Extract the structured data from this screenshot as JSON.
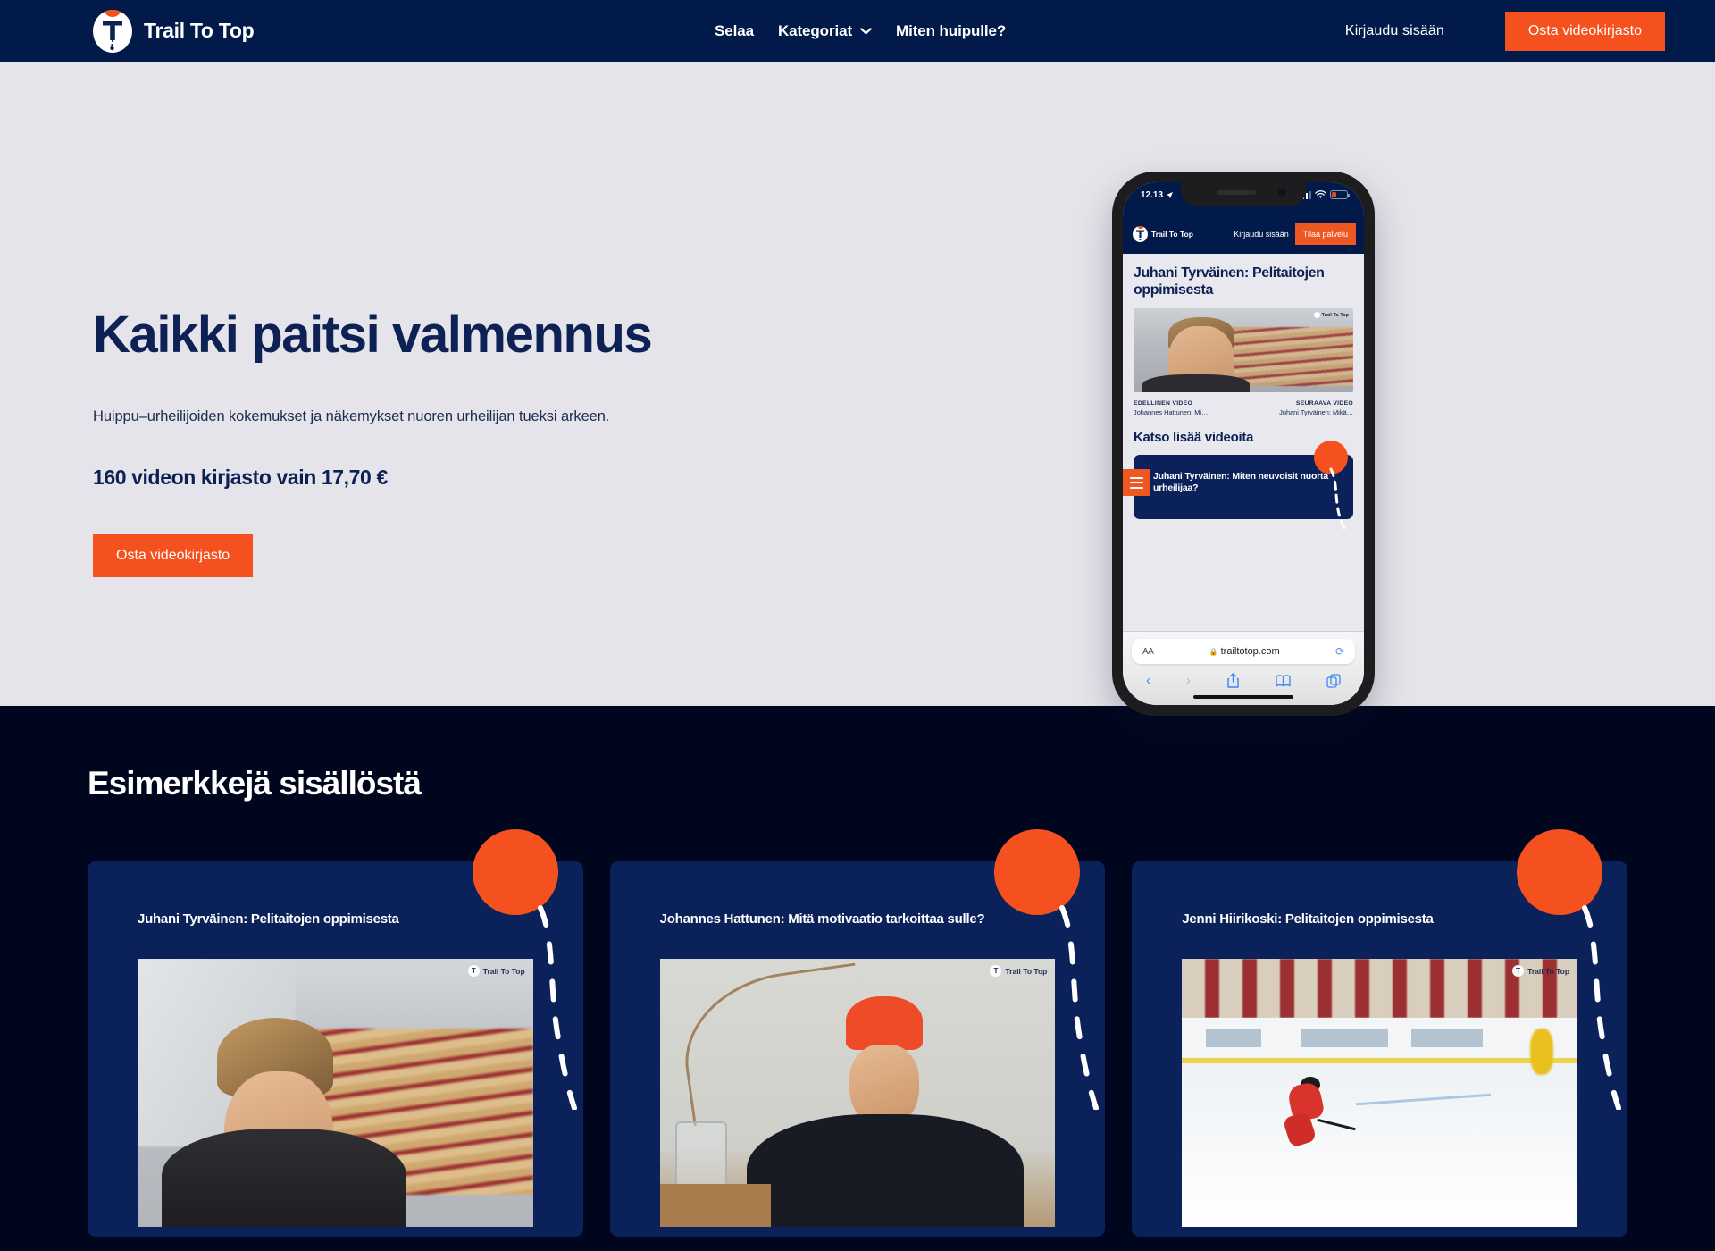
{
  "brand": {
    "name": "Trail To Top",
    "logo_icon": "trail-to-top-logo-icon"
  },
  "header": {
    "nav": [
      {
        "label": "Selaa",
        "has_dropdown": false
      },
      {
        "label": "Kategoriat",
        "has_dropdown": true,
        "dropdown_icon": "chevron-down-icon"
      },
      {
        "label": "Miten huipulle?",
        "has_dropdown": false
      }
    ],
    "login_label": "Kirjaudu sisään",
    "cta_label": "Osta videokirjasto"
  },
  "hero": {
    "title": "Kaikki paitsi valmennus",
    "subtitle": "Huippu–urheilijoiden kokemukset ja näkemykset nuoren urheilijan tueksi arkeen.",
    "price_line": "160 videon kirjasto vain 17,70 €",
    "cta_label": "Osta videokirjasto"
  },
  "phone": {
    "status": {
      "time": "12.13",
      "location_icon": "location-arrow-icon",
      "signal_icon": "cellular-bars-icon",
      "wifi_icon": "wifi-icon",
      "battery_icon": "battery-low-icon"
    },
    "nav": {
      "brand": "Trail To Top",
      "login_label": "Kirjaudu sisään",
      "subscribe_label": "Tilaa palvelu"
    },
    "page_title": "Juhani Tyrväinen: Pelitaitojen oppimisesta",
    "video_nav": {
      "prev_kicker": "EDELLINEN VIDEO",
      "prev_title": "Johannes Hattunen: Mi…",
      "next_kicker": "SEURAAVA VIDEO",
      "next_title": "Juhani Tyrväinen: Mikä…"
    },
    "more_heading": "Katso lisää videoita",
    "card_title": "Juhani Tyrväinen: Miten neuvoisit nuorta urheilijaa?",
    "menu_icon": "hamburger-menu-icon",
    "browser": {
      "text_size_label": "AA",
      "lock_icon": "lock-icon",
      "url": "trailtotop.com",
      "reload_icon": "reload-icon",
      "back_icon": "chevron-left-icon",
      "forward_icon": "chevron-right-icon",
      "share_icon": "share-icon",
      "bookmarks_icon": "book-icon",
      "tabs_icon": "tabs-icon"
    },
    "watermark": "Trail To Top"
  },
  "examples": {
    "title": "Esimerkkejä sisällöstä",
    "watermark": "Trail To Top",
    "cards": [
      {
        "title": "Juhani Tyrväinen: Pelitaitojen oppimisesta",
        "thumb": "interview-arena-thumbnail"
      },
      {
        "title": "Johannes Hattunen: Mitä motivaatio tarkoittaa sulle?",
        "thumb": "interview-beanie-thumbnail"
      },
      {
        "title": "Jenni Hiirikoski: Pelitaitojen oppimisesta",
        "thumb": "ice-hockey-rink-thumbnail"
      }
    ]
  },
  "colors": {
    "brand_navy": "#011a4a",
    "deep_navy": "#00061d",
    "card_navy": "#0a2159",
    "accent_orange": "#f4511e",
    "hero_bg": "#e5e4ea",
    "text_navy": "#0d2154"
  }
}
